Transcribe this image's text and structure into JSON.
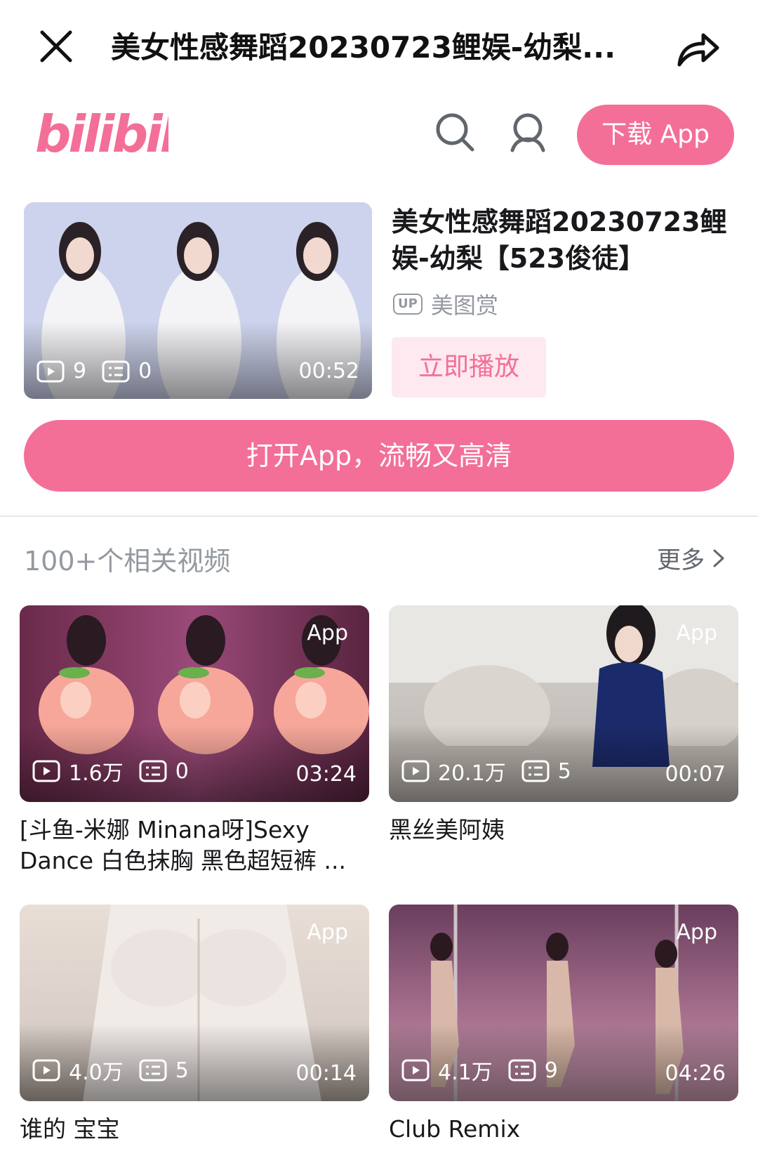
{
  "topbar": {
    "title": "美女性感舞蹈20230723鲤娱-幼梨..."
  },
  "header": {
    "logo_text": "bilibili",
    "download_label": "下载 App"
  },
  "feature": {
    "title": "美女性感舞蹈20230723鲤娱-幼梨【523俊徒】",
    "up_badge": "UP",
    "uploader": "美图赏",
    "plays": "9",
    "danmaku": "0",
    "duration": "00:52",
    "play_now_label": "立即播放"
  },
  "open_app_label": "打开App，流畅又高清",
  "related": {
    "heading": "100+个相关视频",
    "more_label": "更多",
    "app_tag": "App",
    "items": [
      {
        "plays": "1.6万",
        "danmaku": "0",
        "duration": "03:24",
        "title": "[斗鱼-米娜 Minana呀]Sexy Dance 白色抹胸 黑色超短裤 ..."
      },
      {
        "plays": "20.1万",
        "danmaku": "5",
        "duration": "00:07",
        "title": "黑丝美阿姨"
      },
      {
        "plays": "4.0万",
        "danmaku": "5",
        "duration": "00:14",
        "title": "谁的 宝宝"
      },
      {
        "plays": "4.1万",
        "danmaku": "9",
        "duration": "04:26",
        "title": "Club Remix"
      }
    ]
  },
  "colors": {
    "brand_pink": "#f36f98",
    "light_pink": "#fde9ef",
    "muted_gray": "#9499a0"
  },
  "icons": [
    "close-icon",
    "share-icon",
    "search-icon",
    "user-icon",
    "play-count-icon",
    "danmaku-icon",
    "chevron-right-icon"
  ]
}
